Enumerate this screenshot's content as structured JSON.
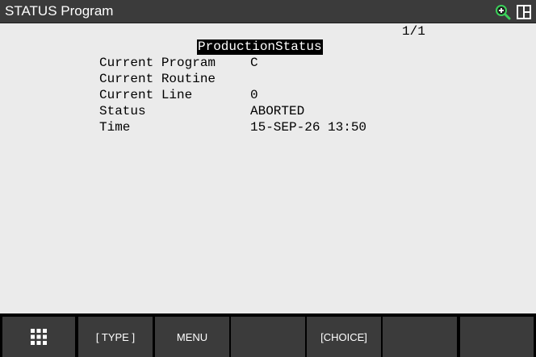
{
  "window": {
    "title": "STATUS Program"
  },
  "header_icons": {
    "zoom": "zoom-in-icon",
    "layout": "screen-layout-icon",
    "zoom_color": "#3bd15a"
  },
  "content": {
    "page_indicator": "1/1",
    "section_title": "ProductionStatus",
    "fields": [
      {
        "label": "Current Program",
        "value": "C"
      },
      {
        "label": "Current Routine",
        "value": ""
      },
      {
        "label": "Current Line",
        "value": "0"
      },
      {
        "label": "Status",
        "value": "ABORTED"
      },
      {
        "label": "Time",
        "value": "15-SEP-26 13:50"
      }
    ]
  },
  "function_keys": {
    "f0_icon": "grid-menu-icon",
    "f1": "[ TYPE ]",
    "f2": "MENU",
    "f3": "",
    "f4": "[CHOICE]",
    "f5": "",
    "f6": ""
  },
  "colors": {
    "title_bar": "#3b3b3b",
    "content_bg": "#ebebeb",
    "key_bg": "#3b3b3b",
    "text": "#000000"
  }
}
